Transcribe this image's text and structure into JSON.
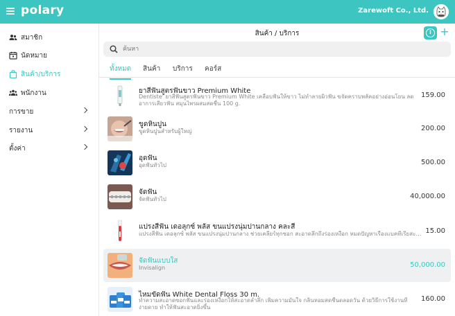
{
  "app": {
    "logo": "polary",
    "company": "Zarewoft Co., Ltd."
  },
  "sidebar": {
    "items": [
      {
        "label": "สมาชิก",
        "icon": "members-icon"
      },
      {
        "label": "นัดหมาย",
        "icon": "calendar-icon"
      },
      {
        "label": "สินค้า/บริการ",
        "icon": "shopping-bag-icon",
        "active": true
      },
      {
        "label": "พนักงาน",
        "icon": "staff-icon"
      }
    ],
    "groups": [
      {
        "label": "การขาย"
      },
      {
        "label": "รายงาน"
      },
      {
        "label": "ตั้งค่า"
      }
    ]
  },
  "header": {
    "title": "สินค้า / บริการ"
  },
  "search": {
    "placeholder": "ค้นหา",
    "value": ""
  },
  "tabs": [
    {
      "label": "ทั้งหมด",
      "active": true
    },
    {
      "label": "สินค้า"
    },
    {
      "label": "บริการ"
    },
    {
      "label": "คอร์ส"
    }
  ],
  "products": [
    {
      "name": "ยาสีฟันสูตรฟันขาว Premium White",
      "desc": "Dentiste' ยาสีฟันสูตรฟันขาว Premium White เคลือบฟันให้ขาว ไม่ทำลายผิวฟัน ขจัดคราบพลัคอย่างอ่อนโยน ลดอาการเสียวฟัน สมุนไพรผสมสดชื่น 100 g.",
      "price": "159.00",
      "thumb": "toothpaste"
    },
    {
      "name": "ขูดหินปูน",
      "desc": "ขูดหินปูนสำหรับผู้ใหญ่",
      "price": "200.00",
      "thumb": "scaling"
    },
    {
      "name": "อุดฟัน",
      "desc": "อุดฟันทั่วไป",
      "price": "500.00",
      "thumb": "filling"
    },
    {
      "name": "จัดฟัน",
      "desc": "จัดฟันทั่วไป",
      "price": "40,000.00",
      "thumb": "braces"
    },
    {
      "name": "แปรงสีฟัน เดอลุกซ์ พลัส ขนแปรงนุ่มปานกลาง คละสี",
      "desc": "แปรงสีฟัน เดอลุกซ์ พลัส ขนแปรงนุ่มปานกลาง ช่วยเคลียร์ทุกซอก สะอาดลึกถึงร่องเหงือก หมดปัญหาเรื่องแบคทีเรียสะสมในช่องปาก",
      "price": "15.00",
      "thumb": "toothbrush"
    },
    {
      "name": "จัดฟันแบบใส",
      "desc": "Invisalign",
      "price": "50,000.00",
      "thumb": "aligner",
      "selected": true
    },
    {
      "name": "ไหมขัดฟัน White Dental Floss 30 m.",
      "desc": "ทำความสะอาดซอกฟันและร่องเหงือกให้สะอาดล้ำลึก เพิ่มความมั่นใจ กลิ่นหอมสดชื่นตลอดวัน ด้วยวิธีการใช้งานที่ง่ายดาย ทำให้ฟันสะอาดยิ่งขึ้น",
      "price": "160.00",
      "thumb": "floss"
    }
  ],
  "colors": {
    "accent": "#3cc5c1",
    "selected_row": "#eef0f2"
  }
}
